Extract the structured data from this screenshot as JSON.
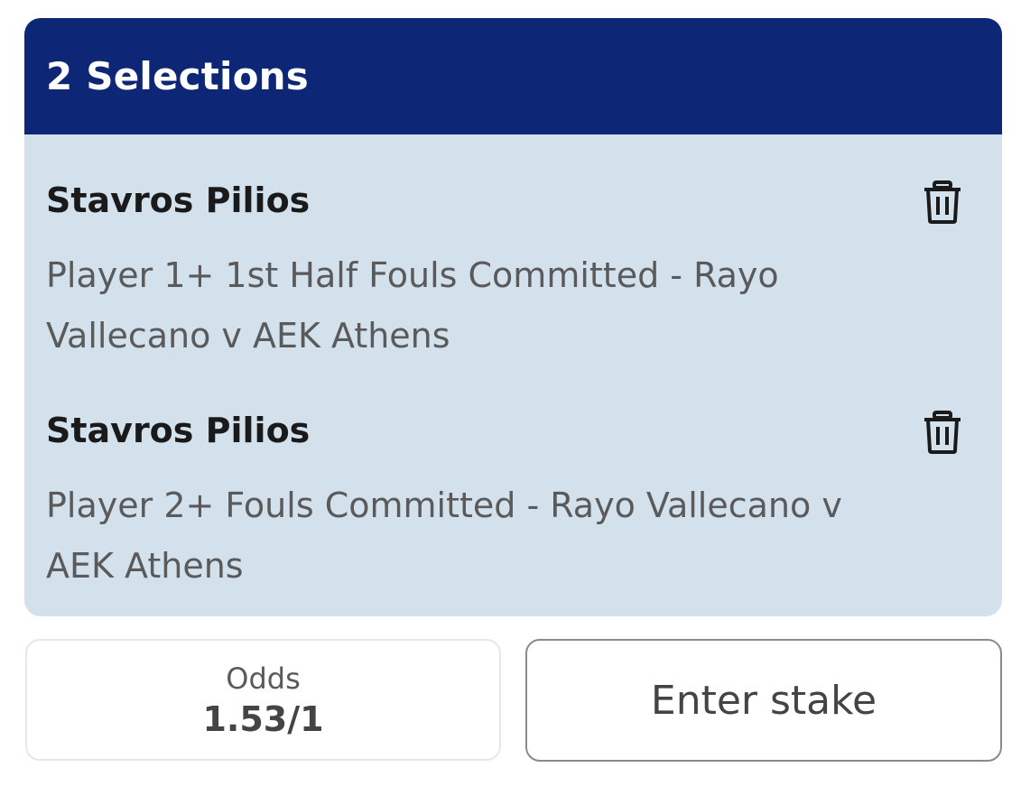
{
  "betslip": {
    "header_title": "2 Selections",
    "selections": [
      {
        "name": "Stavros Pilios",
        "description": "Player 1+ 1st Half Fouls Committed - Rayo Vallecano v AEK Athens",
        "remove_icon": "trash-icon"
      },
      {
        "name": "Stavros Pilios",
        "description": "Player 2+ Fouls Committed - Rayo Vallecano v AEK Athens",
        "remove_icon": "trash-icon"
      }
    ],
    "odds": {
      "label": "Odds",
      "value": "1.53/1"
    },
    "stake": {
      "placeholder": "Enter stake"
    }
  },
  "colors": {
    "header_bg": "#0e2676",
    "card_bg": "#d3e1ed"
  }
}
